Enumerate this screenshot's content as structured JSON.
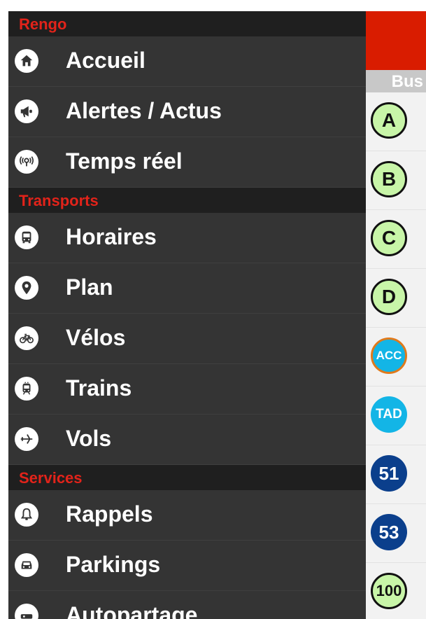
{
  "menu": {
    "sections": [
      {
        "title": "Rengo",
        "items": [
          {
            "label": "Accueil",
            "icon": "home-icon"
          },
          {
            "label": "Alertes / Actus",
            "icon": "megaphone-icon"
          },
          {
            "label": "Temps réel",
            "icon": "realtime-signal-icon"
          }
        ]
      },
      {
        "title": "Transports",
        "items": [
          {
            "label": "Horaires",
            "icon": "bus-icon"
          },
          {
            "label": "Plan",
            "icon": "map-pin-icon"
          },
          {
            "label": "Vélos",
            "icon": "bicycle-icon"
          },
          {
            "label": "Trains",
            "icon": "train-icon"
          },
          {
            "label": "Vols",
            "icon": "airplane-icon"
          }
        ]
      },
      {
        "title": "Services",
        "items": [
          {
            "label": "Rappels",
            "icon": "bell-icon"
          },
          {
            "label": "Parkings",
            "icon": "car-icon"
          },
          {
            "label": "Autopartage",
            "icon": "carsharing-icon"
          }
        ]
      }
    ]
  },
  "sidebar": {
    "header": "Bus",
    "lines": [
      "A",
      "B",
      "C",
      "D",
      "ACC",
      "TAD",
      "51",
      "53",
      "100"
    ]
  },
  "colors": {
    "accent_red": "#e2231a",
    "menu_bg": "#333333",
    "line_green": "#c8f5a8",
    "line_cyan": "#13b5e6",
    "line_blue": "#0b3f8c",
    "line_orange": "#e07a1c"
  }
}
